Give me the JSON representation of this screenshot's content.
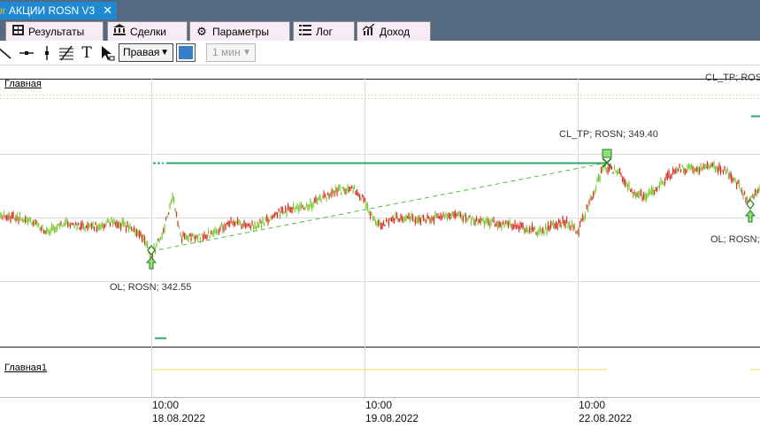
{
  "window": {
    "doc_tab_prefix": "or",
    "doc_tab_title": "АКЦИИ ROSN V3",
    "close_glyph": "✕"
  },
  "panel_tabs": [
    {
      "label": "Результаты",
      "icon": "results-grid-icon"
    },
    {
      "label": "Сделки",
      "icon": "bank-icon"
    },
    {
      "label": "Параметры",
      "icon": "gear-icon"
    },
    {
      "label": "Лог",
      "icon": "list-icon"
    },
    {
      "label": "Доход",
      "icon": "profit-chart-icon"
    }
  ],
  "toolbar": {
    "tools": [
      "trend-line-icon",
      "horizontal-line-icon",
      "vertical-line-icon",
      "fibonacci-icon",
      "text-tool-icon",
      "cursor-tool-icon"
    ],
    "text_tool_glyph": "T",
    "side_select_value": "Правая",
    "color_swatch": "#3a7fc4",
    "timeframe_value": "1 мин"
  },
  "chart": {
    "main_pane_label": "Главная",
    "sub_pane_label": "Главная1",
    "annotations": {
      "entry_1": "OL; ROSN; 342.55",
      "take_profit_1": "CL_TP; ROSN; 349.40",
      "take_profit_2": "CL_TP; ROSN;",
      "entry_2": "OL; ROSN;"
    },
    "x_axis": [
      {
        "time": "10:00",
        "date": "18.08.2022"
      },
      {
        "time": "10:00",
        "date": "19.08.2022"
      },
      {
        "time": "10:00",
        "date": "22.08.2022"
      }
    ],
    "colors": {
      "up": "#7cc832",
      "down": "#d9342b",
      "trade_line": "#2ea86b",
      "trade_link": "#4cbf3a",
      "sub_line": "#e8e06a",
      "grid": "#dcdcdc"
    }
  }
}
